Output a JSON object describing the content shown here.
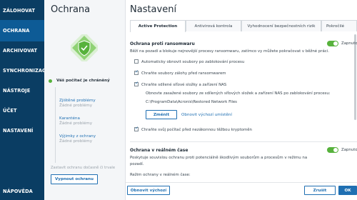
{
  "nav": {
    "items": [
      {
        "label": "ZÁLOHOVAT"
      },
      {
        "label": "OCHRANA"
      },
      {
        "label": "ARCHIVOVAT"
      },
      {
        "label": "SYNCHRONIZACE"
      },
      {
        "label": "NÁSTROJE"
      },
      {
        "label": "ÚČET"
      },
      {
        "label": "NASTAVENÍ"
      },
      {
        "label": "NÁPOVĚDA"
      }
    ],
    "active_index": 1
  },
  "protection": {
    "title": "Ochrana",
    "status": "Váš počítač je chráněný",
    "items": [
      {
        "label": "Zjištěné problémy",
        "sub": "Žádné problémy"
      },
      {
        "label": "Karanténa",
        "sub": "Žádné problémy"
      },
      {
        "label": "Výjimky z ochrany",
        "sub": "Žádné problémy"
      }
    ],
    "pause_note": "Zastavit ochranu dočasně či trvale",
    "turn_off_button": "Vypnout ochranu"
  },
  "settings": {
    "title": "Nastavení",
    "tabs": [
      {
        "label": "Active Protection"
      },
      {
        "label": "Antivirová kontrola"
      },
      {
        "label": "Vyhodnocení bezpečnostních rizik"
      },
      {
        "label": "Pokročilé"
      }
    ],
    "active_tab": 0,
    "ransomware": {
      "title": "Ochrana proti ransomwaru",
      "toggle_label": "Zapnuto",
      "description": "Běží na pozadí a blokuje nejnovější procesy ransomwaru, zatímco vy můžete pokračovat v běžné práci.",
      "options": [
        {
          "label": "Automaticky obnovit soubory po zablokování procesu",
          "checked": false
        },
        {
          "label": "Chraňte soubory zálohy před ransomwarem",
          "checked": true
        },
        {
          "label": "Chraňte sdílené síťové složky a zařízení NAS",
          "checked": true
        }
      ],
      "nas_note": "Obnovte zasažené soubory ze sdílených síťových složek a zařízení NAS po zablokování procesu:",
      "nas_path": "C:\\ProgramData\\Acronis\\Restored Network Files",
      "change_button": "Změnit",
      "restore_default_link": "Obnovit výchozí umístění",
      "crypto_option": {
        "label": "Chraňte svůj počítač před nezákonnou těžbou kryptoměn",
        "checked": true
      }
    },
    "realtime": {
      "title": "Ochrana v reálném čase",
      "toggle_label": "Zapnuto",
      "description_line1": "Poskytuje souvislou ochranu proti potenciálně škodlivým souborům a procesům v režimu na",
      "description_line2": "pozadí.",
      "mode_label": "Režim ochrany v reálném čase:"
    },
    "footer": {
      "restore_defaults": "Obnovit výchozí",
      "cancel": "Zrušit",
      "ok": "OK"
    }
  },
  "colors": {
    "nav_bg": "#0a3d63",
    "nav_active": "#0d5b96",
    "accent": "#1f6fb2",
    "toggle_on": "#57b23c",
    "shield": "#57b23c"
  }
}
